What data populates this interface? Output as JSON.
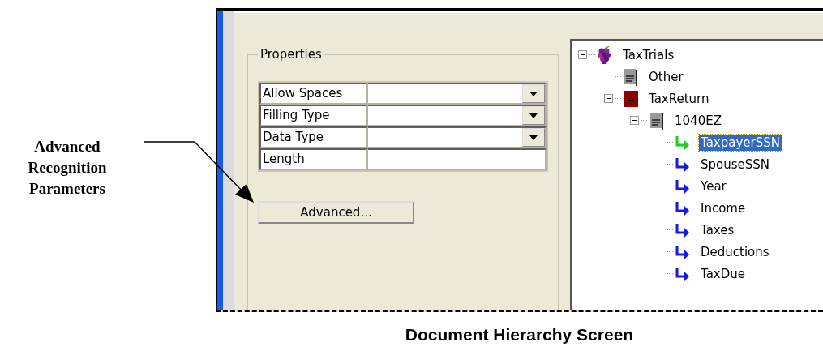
{
  "annotation": {
    "text": "Advanced Recognition Parameters"
  },
  "properties": {
    "title": "Properties",
    "rows": [
      {
        "label": "Allow Spaces",
        "kind": "dropdown"
      },
      {
        "label": "Filling Type",
        "kind": "dropdown"
      },
      {
        "label": "Data Type",
        "kind": "dropdown"
      },
      {
        "label": "Length",
        "kind": "text"
      }
    ],
    "button": "Advanced..."
  },
  "tree": [
    {
      "label": "TaxTrials",
      "kind": "root",
      "expanded": true,
      "selected": false,
      "children": [
        {
          "label": "Other",
          "kind": "document",
          "selected": false
        },
        {
          "label": "TaxReturn",
          "kind": "book",
          "expanded": true,
          "selected": false,
          "children": [
            {
              "label": "1040EZ",
              "kind": "document",
              "expanded": true,
              "selected": false,
              "children": [
                {
                  "label": "TaxpayerSSN",
                  "kind": "field",
                  "selected": true
                },
                {
                  "label": "SpouseSSN",
                  "kind": "field",
                  "selected": false
                },
                {
                  "label": "Year",
                  "kind": "field",
                  "selected": false
                },
                {
                  "label": "Income",
                  "kind": "field",
                  "selected": false
                },
                {
                  "label": "Taxes",
                  "kind": "field",
                  "selected": false
                },
                {
                  "label": "Deductions",
                  "kind": "field",
                  "selected": false
                },
                {
                  "label": "TaxDue",
                  "kind": "field",
                  "selected": false
                }
              ]
            }
          ]
        }
      ]
    }
  ],
  "caption": "Document Hierarchy Screen"
}
